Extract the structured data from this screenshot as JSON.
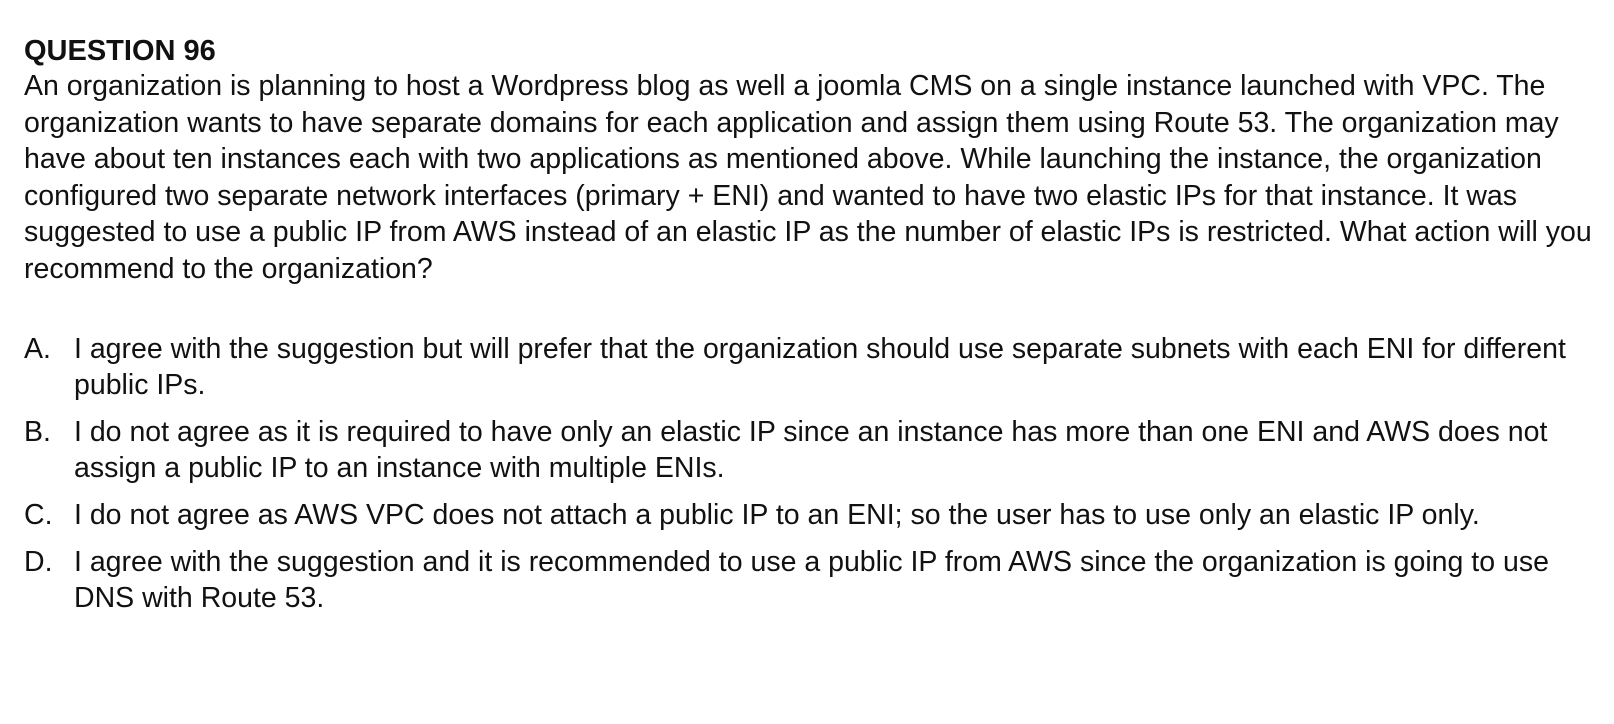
{
  "title": "QUESTION 96",
  "question": "An organization is planning to host a Wordpress blog as well a joomla CMS on a single instance launched with VPC. The organization wants to have separate domains for each application and assign them using Route 53. The organization may have about ten instances each with two applications as mentioned above. While launching the instance, the organization configured two separate network interfaces (primary + ENI) and wanted to have two elastic IPs for that instance. It was suggested to use a public IP from AWS instead of an elastic IP as the number of elastic IPs is restricted. What action will you recommend to the organization?",
  "options": [
    {
      "letter": "A.",
      "text": "I agree with the suggestion but will prefer that the organization should use separate subnets with each ENI for different public IPs."
    },
    {
      "letter": "B.",
      "text": "I do not agree as it is required to have only an elastic IP since an instance has more than one ENI and AWS does not assign a public IP to an instance with multiple ENIs."
    },
    {
      "letter": "C.",
      "text": "I do not agree as AWS VPC does not attach a public IP to an ENI; so the user has to use only an elastic IP only."
    },
    {
      "letter": "D.",
      "text": "I agree with the suggestion and it is recommended to use a public IP from AWS since the organization is going to use DNS with Route 53."
    }
  ]
}
